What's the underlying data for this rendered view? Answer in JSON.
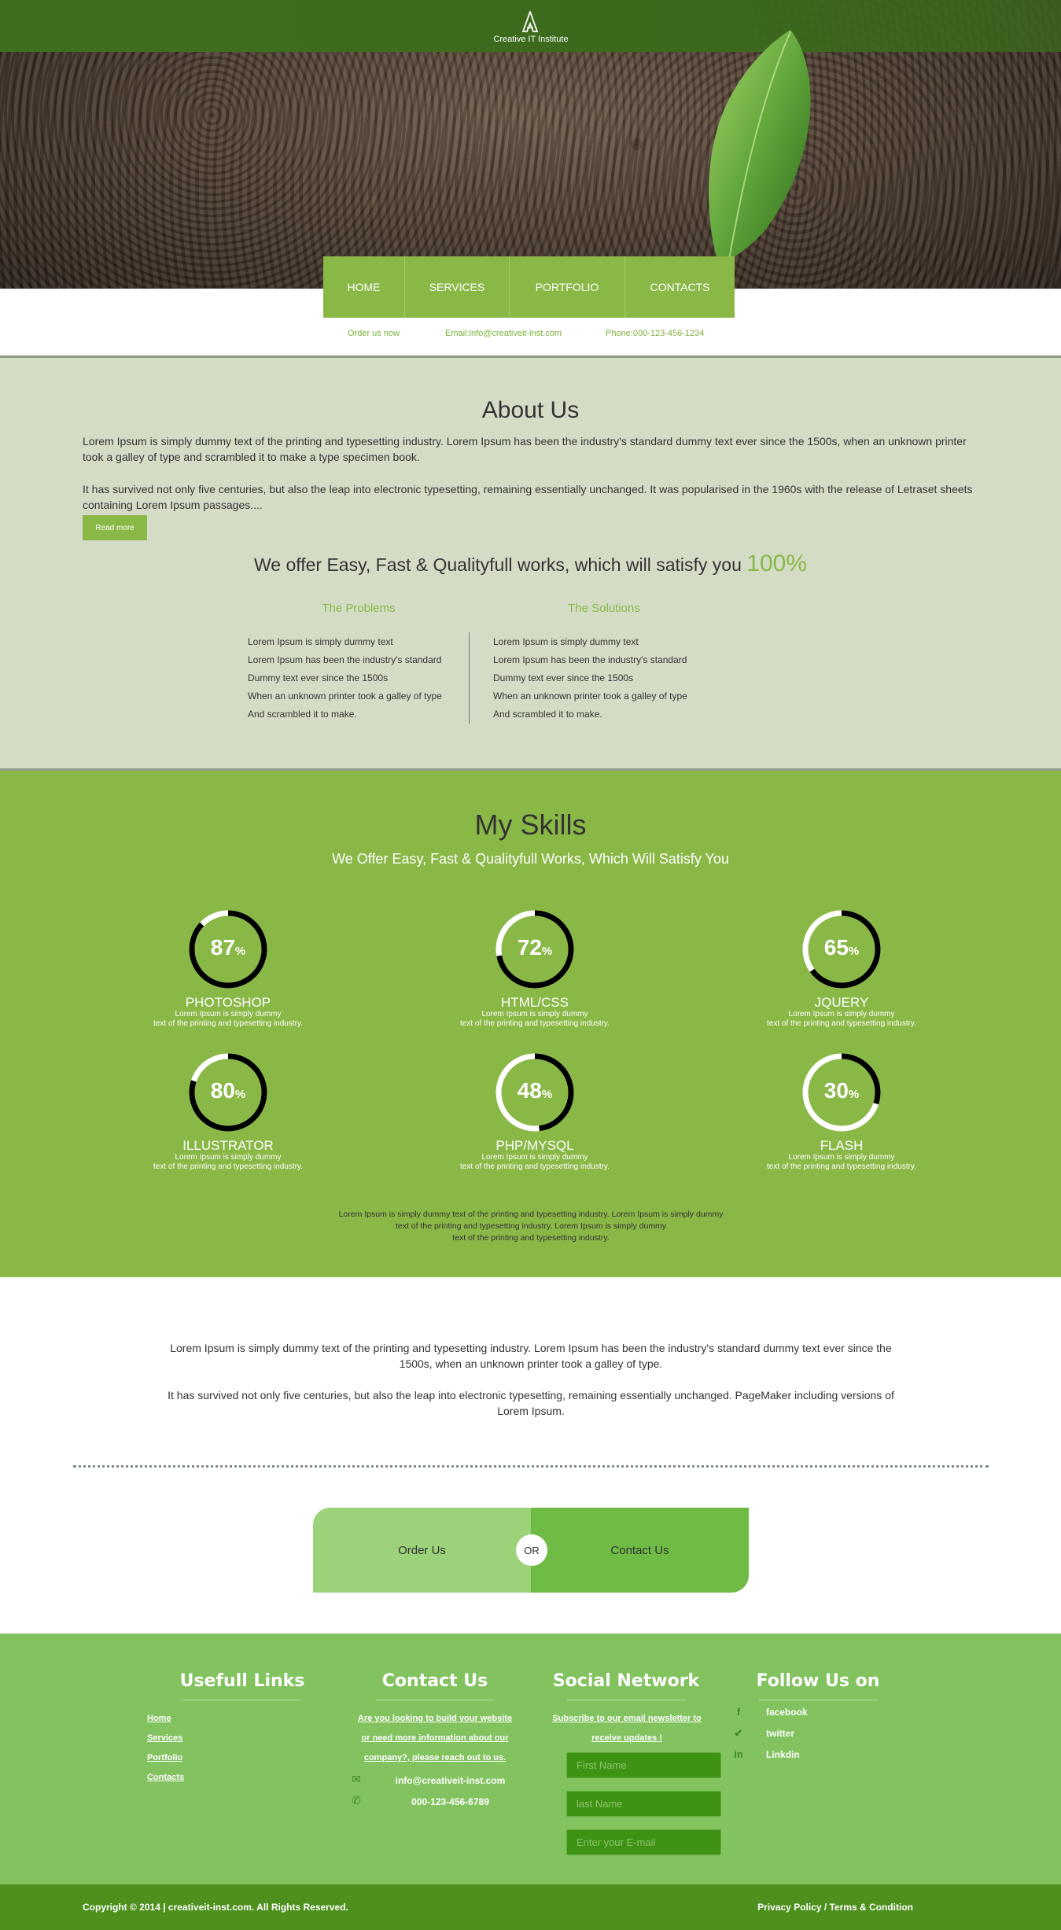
{
  "brand": {
    "name": "Creative IT Institute",
    "logo_icon": "abstract-a-logo-icon"
  },
  "nav": [
    {
      "label": "HOME"
    },
    {
      "label": "SERVICES"
    },
    {
      "label": "PORTFOLIO"
    },
    {
      "label": "CONTACTS"
    }
  ],
  "contact_strip": {
    "order": "Order us now",
    "email": "Email:info@creativeit-inst.com",
    "phone": "Phone:000-123-456-1234"
  },
  "about": {
    "title": "About Us",
    "p1": "Lorem Ipsum is simply dummy text of the printing and typesetting industry. Lorem Ipsum has been the industry's standard dummy text ever since the 1500s, when an unknown printer took a galley of type and scrambled it to make a type specimen book.",
    "p2": "It has survived not only five centuries, but also the leap into electronic typesetting, remaining essentially unchanged. It was popularised in the 1960s with the release of Letraset sheets containing Lorem Ipsum passages....",
    "read_more": "Read more",
    "offer_text": "We offer Easy, Fast & Qualityfull works, which will satisfy you",
    "offer_pct": "100%",
    "problems": {
      "title": "The Problems",
      "items": [
        "Lorem Ipsum is simply dummy text",
        "Lorem Ipsum has been the industry's standard",
        "Dummy text ever since the 1500s",
        "When an unknown printer took a galley of type",
        "And scrambled it to make."
      ]
    },
    "solutions": {
      "title": "The Solutions",
      "items": [
        "Lorem Ipsum is simply dummy text",
        "Lorem Ipsum has been the industry's standard",
        "Dummy text ever since the 1500s",
        "When an unknown printer took a galley of type",
        "And scrambled it to make."
      ]
    }
  },
  "skills": {
    "title": "My Skills",
    "subtitle": "We Offer Easy, Fast & Qualityfull Works, Which Will Satisfy You",
    "items": [
      {
        "name": "PHOTOSHOP",
        "percent": 87,
        "pct_label": "87",
        "desc1": "Lorem Ipsum is simply dummy",
        "desc2": "text of the printing and typesetting industry."
      },
      {
        "name": "HTML/CSS",
        "percent": 72,
        "pct_label": "72",
        "desc1": "Lorem Ipsum is simply dummy",
        "desc2": "text of the printing and typesetting industry."
      },
      {
        "name": "JQUERY",
        "percent": 65,
        "pct_label": "65",
        "desc1": "Lorem Ipsum is simply dummy",
        "desc2": "text of the printing and typesetting industry."
      },
      {
        "name": "ILLUSTRATOR",
        "percent": 80,
        "pct_label": "80",
        "desc1": "Lorem Ipsum is simply dummy",
        "desc2": "text of the printing and typesetting industry."
      },
      {
        "name": "PHP/MYSQL",
        "percent": 48,
        "pct_label": "48",
        "desc1": "Lorem Ipsum is simply dummy",
        "desc2": "text of the printing and typesetting industry."
      },
      {
        "name": "FLASH",
        "percent": 30,
        "pct_label": "30",
        "desc1": "Lorem Ipsum is simply dummy",
        "desc2": "text of the printing and typesetting industry."
      }
    ],
    "pct_sign": "%",
    "footer_l1": "Lorem Ipsum is simply dummy text of the printing and typesetting industry. Lorem Ipsum is simply dummy",
    "footer_l2": "text of the printing and typesetting industry. Lorem Ipsum is simply dummy",
    "footer_l3": "text of the printing and typesetting industry."
  },
  "mid": {
    "p1": "Lorem Ipsum is simply dummy text of the printing and typesetting industry. Lorem Ipsum has been the industry's standard dummy text ever since the 1500s, when an unknown printer took a galley of type.",
    "p2": "It has survived not only five centuries, but also the leap into electronic typesetting, remaining essentially unchanged. PageMaker including versions of Lorem Ipsum."
  },
  "cta": {
    "order": "Order Us",
    "or": "OR",
    "contact": "Contact Us"
  },
  "footer": {
    "links": {
      "title": "Usefull Links",
      "items": [
        "Home",
        "Services",
        "Portfolio",
        "Contacts"
      ]
    },
    "contact": {
      "title": "Contact Us",
      "l1": "Are you looking to build your website",
      "l2": "or need more information about our",
      "l3": "company?, please reach out to us.",
      "email": "info@creativeit-inst.com",
      "phone": "000-123-456-6789"
    },
    "social": {
      "title": "Social Network",
      "l1": "Subscribe to our email newsletter to",
      "l2": "receive updates !",
      "first_name": "First Name",
      "last_name": "last Name",
      "email": "Enter your E-mail"
    },
    "follow": {
      "title": "Follow Us on",
      "items": [
        {
          "icon": "facebook-icon",
          "label": "facebook"
        },
        {
          "icon": "twitter-icon",
          "label": "twitter"
        },
        {
          "icon": "linkedin-icon",
          "label": "Linkdin"
        }
      ]
    }
  },
  "copyright": {
    "left": "Copyright © 2014 | creativeit-inst.com. All Rights Reserved.",
    "right": "Privacy Policy / Terms & Condition"
  },
  "colors": {
    "accent": "#8ab847",
    "dark_green": "#4d901d",
    "about_bg": "#d4dcc6",
    "footer_bg": "#82c35f"
  }
}
